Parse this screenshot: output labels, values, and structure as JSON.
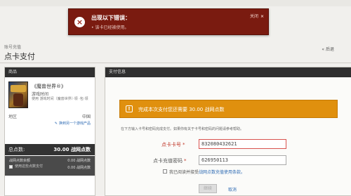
{
  "error": {
    "title": "出现以下错误：",
    "message": "• 该卡已经被使用。",
    "close_label": "关闭",
    "close_icon": "x-icon"
  },
  "page": {
    "breadcrumb": "账号充值",
    "title": "点卡支付",
    "back_label": "后退",
    "back_icon": "arrow-left-icon"
  },
  "left_panel": {
    "header": "商品",
    "product_name": "《魔兽世界®》",
    "product_type": "游戏时间",
    "product_desc": "使用 游戏时间（魔兽世界）·领 ·包·领",
    "region_label": "地区",
    "region_value": "中国",
    "switch_link": "换到另一个游戏产品",
    "total_label": "总点数:",
    "total_value": "30.00 战网点数",
    "balance_label": "战网点数余额",
    "balance_value": "0.00 战网点数",
    "use_balance_text": "使用这些点数支付",
    "use_balance_value": "0.00 战网点数"
  },
  "right_panel": {
    "header": "支付信息",
    "notice": "完成本次支付您还需要 30.00 战网点数",
    "instructions": "在下方输入卡号和密码完成支付。如果你有关于卡号和密码的问题请参考帮助。",
    "card_label": "点卡卡号",
    "pin_label": "点卡充值密码",
    "card_value": "832080432621",
    "pin_value": "626950113",
    "agree_prefix": "我已阅读并接受",
    "agree_link": "战网点数充值使用条款。",
    "submit_label": "继续",
    "cancel_label": "取消"
  },
  "colors": {
    "error_bg": "#7a1b10",
    "notice_bg": "#e0900e",
    "dark_panel": "#333333",
    "link": "#2d6ab3"
  }
}
